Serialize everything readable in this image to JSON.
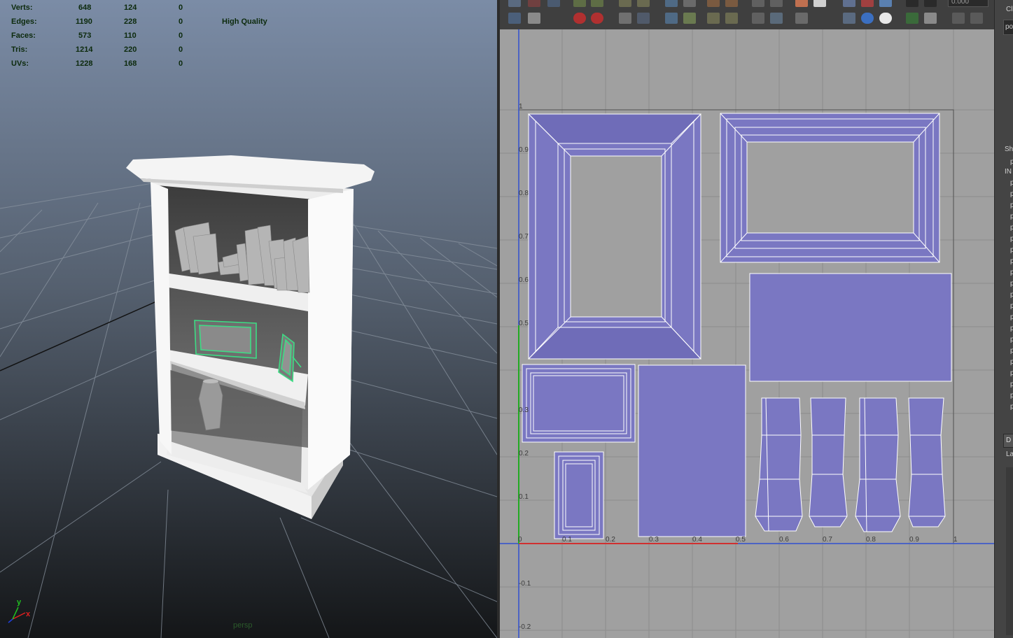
{
  "hud": {
    "rows": [
      {
        "label": "Verts:",
        "a": "648",
        "b": "124",
        "c": "0"
      },
      {
        "label": "Edges:",
        "a": "1190",
        "b": "228",
        "c": "0"
      },
      {
        "label": "Faces:",
        "a": "573",
        "b": "110",
        "c": "0"
      },
      {
        "label": "Tris:",
        "a": "1214",
        "b": "220",
        "c": "0"
      },
      {
        "label": "UVs:",
        "a": "1228",
        "b": "168",
        "c": "0"
      }
    ],
    "quality": "High Quality"
  },
  "viewport": {
    "camera": "persp",
    "axis_y": "y",
    "axis_x": "x"
  },
  "uv_editor": {
    "zoom_value": "0.000",
    "u_ticks": [
      "0",
      "0.1",
      "0.2",
      "0.3",
      "0.4",
      "0.5",
      "0.6",
      "0.7",
      "0.8",
      "0.9",
      "1"
    ],
    "v_ticks": [
      "1",
      "0.9",
      "0.8",
      "0.7",
      "0.6",
      "0.5",
      "0.4",
      "0.3",
      "0.2",
      "0.1",
      "-0.1",
      "-0.2"
    ]
  },
  "right_panel": {
    "top": "po",
    "cl": "Cl",
    "sh": "Sh",
    "in": "IN",
    "p_rows": [
      "p",
      "p",
      "p",
      "p",
      "p",
      "p",
      "p",
      "p",
      "p",
      "p",
      "p",
      "p",
      "p",
      "p",
      "p",
      "p",
      "p",
      "p",
      "p",
      "p",
      "p",
      "p"
    ],
    "d": "D",
    "la": "La"
  },
  "colors": {
    "uv_fill": "#7a77c2",
    "uv_grid_bg": "#a0a0a0",
    "selection": "#3ddc84",
    "u_axis": "#d03030",
    "v_axis": "#22aa22"
  }
}
